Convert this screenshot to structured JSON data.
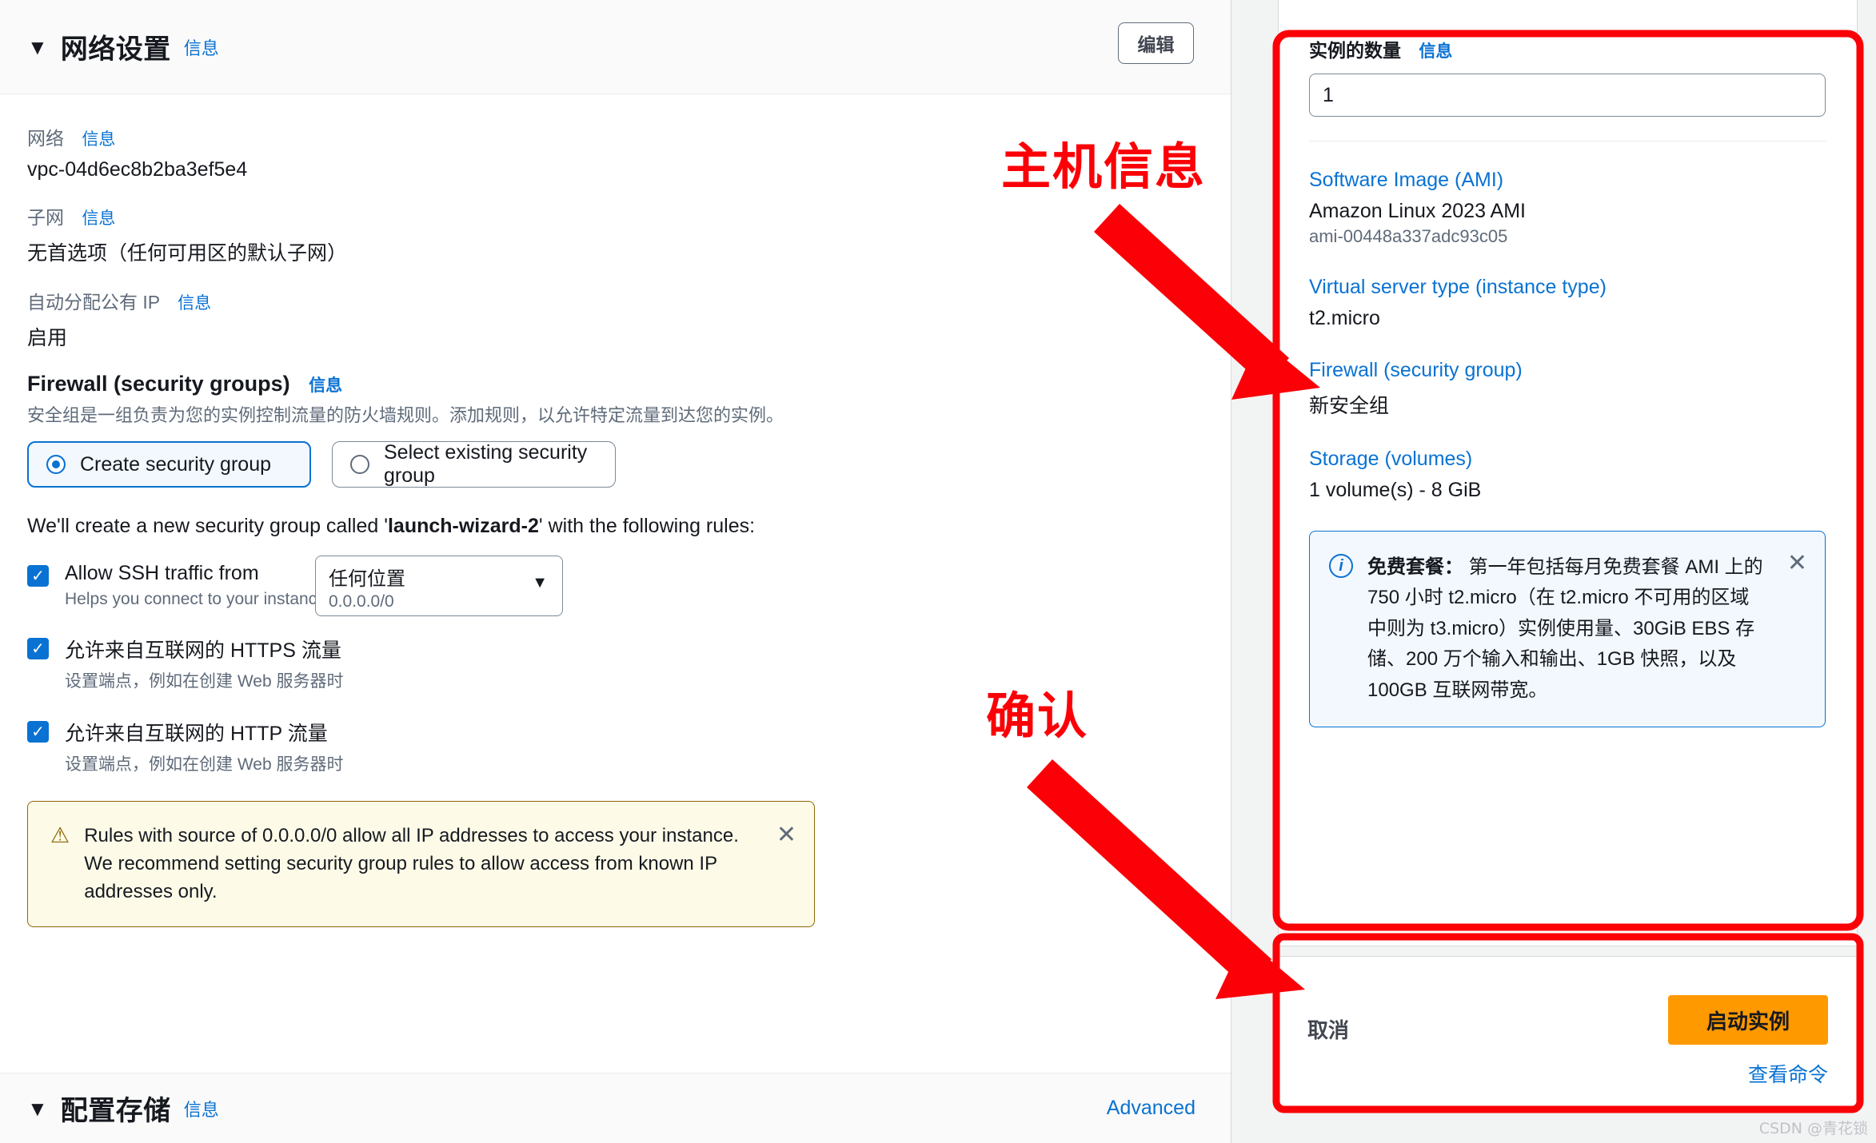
{
  "left_panel": {
    "header": {
      "title": "网络设置",
      "info_label": "信息",
      "edit_label": "编辑",
      "caret": "▼"
    },
    "fields": [
      {
        "label": "网络",
        "info_label": "信息",
        "value": "vpc-04d6ec8b2ba3ef5e4"
      },
      {
        "label": "子网",
        "info_label": "信息",
        "value": "无首选项（任何可用区的默认子网）"
      },
      {
        "label": "自动分配公有 IP",
        "info_label": "信息",
        "value": "启用"
      }
    ],
    "firewall": {
      "heading": "Firewall (security groups)",
      "info_label": "信息",
      "description": "安全组是一组负责为您的实例控制流量的防火墙规则。添加规则，以允许特定流量到达您的实例。",
      "options": [
        {
          "label": "Create security group",
          "selected": true
        },
        {
          "label": "Select existing security group",
          "selected": false
        }
      ],
      "note_prefix": "We'll create a new security group called '",
      "note_group_name": "launch-wizard-2",
      "note_suffix": "' with the following rules:",
      "rules": [
        {
          "title": "Allow SSH traffic from",
          "subtitle": "Helps you connect to your instance",
          "checked": true,
          "check_glyph": "✓"
        },
        {
          "title": "允许来自互联网的 HTTPS 流量",
          "subtitle": "设置端点，例如在创建 Web 服务器时",
          "checked": true,
          "check_glyph": "✓"
        },
        {
          "title": "允许来自互联网的 HTTP 流量",
          "subtitle": "设置端点，例如在创建 Web 服务器时",
          "checked": true,
          "check_glyph": "✓"
        }
      ],
      "ssh_source_select": {
        "value": "任何位置",
        "detail": "0.0.0.0/0",
        "caret": "▼"
      }
    },
    "warning": {
      "icon": "⚠",
      "text": "Rules with source of 0.0.0.0/0 allow all IP addresses to access your instance. We recommend setting security group rules to allow access from known IP addresses only.",
      "close_glyph": "✕"
    },
    "storage_section": {
      "caret": "▼",
      "title": "配置存储",
      "info_label": "信息",
      "advanced_label": "Advanced"
    }
  },
  "summary_panel": {
    "instance_count": {
      "label": "实例的数量",
      "info_label": "信息",
      "value": "1"
    },
    "items": [
      {
        "link": "Software Image (AMI)",
        "value": "Amazon Linux 2023 AMI",
        "sub": "ami-00448a337adc93c05"
      },
      {
        "link": "Virtual server type (instance type)",
        "value": "t2.micro",
        "sub": ""
      },
      {
        "link": "Firewall (security group)",
        "value": "新安全组",
        "sub": ""
      },
      {
        "link": "Storage (volumes)",
        "value": "1 volume(s) - 8 GiB",
        "sub": ""
      }
    ],
    "free_tier": {
      "icon": "i",
      "title": "免费套餐：",
      "body": " 第一年包括每月免费套餐 AMI 上的 750 小时 t2.micro（在 t2.micro 不可用的区域中则为 t3.micro）实例使用量、30GiB EBS 存储、200 万个输入和输出、1GB 快照，以及 100GB 互联网带宽。",
      "close_glyph": "✕"
    },
    "actions": {
      "cancel_label": "取消",
      "launch_label": "启动实例",
      "view_command_label": "查看命令"
    }
  },
  "annotations": {
    "host_info": "主机信息",
    "confirm": "确认",
    "color": "#fb0007"
  },
  "watermark": "CSDN @青花锁"
}
